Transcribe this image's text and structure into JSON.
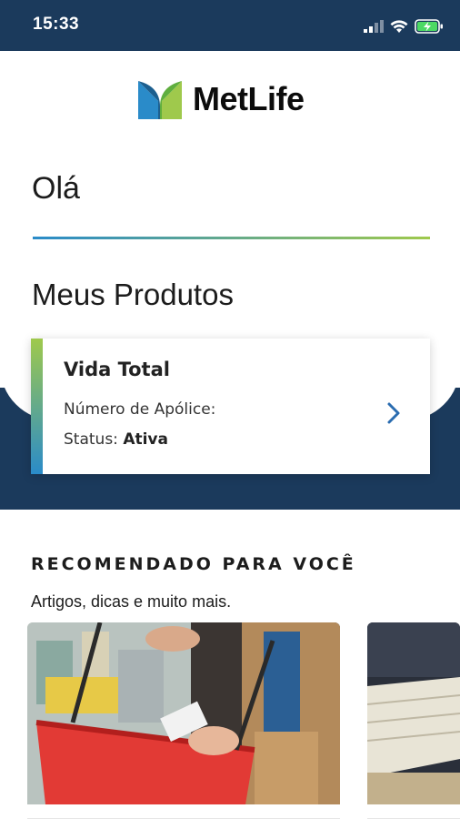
{
  "status_bar": {
    "time": "15:33",
    "icons": [
      "signal-icon",
      "wifi-icon",
      "battery-charging-icon"
    ]
  },
  "logo": {
    "text": "MetLife",
    "colors": {
      "green": "#9fc94c",
      "blue": "#2a8bc9",
      "dark_blue": "#1c5f8f"
    }
  },
  "greeting": "Olá",
  "products": {
    "title": "Meus Produtos",
    "card": {
      "name": "Vida Total",
      "policy_label": "Número de Apólice:",
      "policy_value": "",
      "status_label": "Status:",
      "status_value": "Ativa",
      "chevron": "chevron-right-icon"
    }
  },
  "recommended": {
    "title": "RECOMENDADO PARA VOCÊ",
    "subtitle": "Artigos, dicas e muito mais.",
    "articles": [
      {
        "image": "shopping-basket-photo"
      },
      {
        "image": "documents-photo"
      }
    ]
  },
  "colors": {
    "navy": "#1b3a5c",
    "accent_green": "#9fc94c",
    "accent_blue": "#2a8bc9"
  }
}
